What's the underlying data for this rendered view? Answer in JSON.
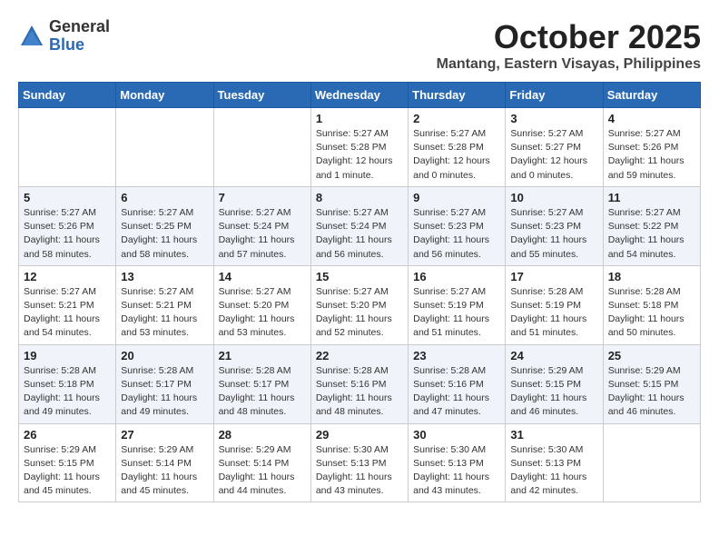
{
  "header": {
    "logo_general": "General",
    "logo_blue": "Blue",
    "month": "October 2025",
    "location": "Mantang, Eastern Visayas, Philippines"
  },
  "weekdays": [
    "Sunday",
    "Monday",
    "Tuesday",
    "Wednesday",
    "Thursday",
    "Friday",
    "Saturday"
  ],
  "weeks": [
    [
      {
        "day": "",
        "sunrise": "",
        "sunset": "",
        "daylight": ""
      },
      {
        "day": "",
        "sunrise": "",
        "sunset": "",
        "daylight": ""
      },
      {
        "day": "",
        "sunrise": "",
        "sunset": "",
        "daylight": ""
      },
      {
        "day": "1",
        "sunrise": "Sunrise: 5:27 AM",
        "sunset": "Sunset: 5:28 PM",
        "daylight": "Daylight: 12 hours and 1 minute."
      },
      {
        "day": "2",
        "sunrise": "Sunrise: 5:27 AM",
        "sunset": "Sunset: 5:28 PM",
        "daylight": "Daylight: 12 hours and 0 minutes."
      },
      {
        "day": "3",
        "sunrise": "Sunrise: 5:27 AM",
        "sunset": "Sunset: 5:27 PM",
        "daylight": "Daylight: 12 hours and 0 minutes."
      },
      {
        "day": "4",
        "sunrise": "Sunrise: 5:27 AM",
        "sunset": "Sunset: 5:26 PM",
        "daylight": "Daylight: 11 hours and 59 minutes."
      }
    ],
    [
      {
        "day": "5",
        "sunrise": "Sunrise: 5:27 AM",
        "sunset": "Sunset: 5:26 PM",
        "daylight": "Daylight: 11 hours and 58 minutes."
      },
      {
        "day": "6",
        "sunrise": "Sunrise: 5:27 AM",
        "sunset": "Sunset: 5:25 PM",
        "daylight": "Daylight: 11 hours and 58 minutes."
      },
      {
        "day": "7",
        "sunrise": "Sunrise: 5:27 AM",
        "sunset": "Sunset: 5:24 PM",
        "daylight": "Daylight: 11 hours and 57 minutes."
      },
      {
        "day": "8",
        "sunrise": "Sunrise: 5:27 AM",
        "sunset": "Sunset: 5:24 PM",
        "daylight": "Daylight: 11 hours and 56 minutes."
      },
      {
        "day": "9",
        "sunrise": "Sunrise: 5:27 AM",
        "sunset": "Sunset: 5:23 PM",
        "daylight": "Daylight: 11 hours and 56 minutes."
      },
      {
        "day": "10",
        "sunrise": "Sunrise: 5:27 AM",
        "sunset": "Sunset: 5:23 PM",
        "daylight": "Daylight: 11 hours and 55 minutes."
      },
      {
        "day": "11",
        "sunrise": "Sunrise: 5:27 AM",
        "sunset": "Sunset: 5:22 PM",
        "daylight": "Daylight: 11 hours and 54 minutes."
      }
    ],
    [
      {
        "day": "12",
        "sunrise": "Sunrise: 5:27 AM",
        "sunset": "Sunset: 5:21 PM",
        "daylight": "Daylight: 11 hours and 54 minutes."
      },
      {
        "day": "13",
        "sunrise": "Sunrise: 5:27 AM",
        "sunset": "Sunset: 5:21 PM",
        "daylight": "Daylight: 11 hours and 53 minutes."
      },
      {
        "day": "14",
        "sunrise": "Sunrise: 5:27 AM",
        "sunset": "Sunset: 5:20 PM",
        "daylight": "Daylight: 11 hours and 53 minutes."
      },
      {
        "day": "15",
        "sunrise": "Sunrise: 5:27 AM",
        "sunset": "Sunset: 5:20 PM",
        "daylight": "Daylight: 11 hours and 52 minutes."
      },
      {
        "day": "16",
        "sunrise": "Sunrise: 5:27 AM",
        "sunset": "Sunset: 5:19 PM",
        "daylight": "Daylight: 11 hours and 51 minutes."
      },
      {
        "day": "17",
        "sunrise": "Sunrise: 5:28 AM",
        "sunset": "Sunset: 5:19 PM",
        "daylight": "Daylight: 11 hours and 51 minutes."
      },
      {
        "day": "18",
        "sunrise": "Sunrise: 5:28 AM",
        "sunset": "Sunset: 5:18 PM",
        "daylight": "Daylight: 11 hours and 50 minutes."
      }
    ],
    [
      {
        "day": "19",
        "sunrise": "Sunrise: 5:28 AM",
        "sunset": "Sunset: 5:18 PM",
        "daylight": "Daylight: 11 hours and 49 minutes."
      },
      {
        "day": "20",
        "sunrise": "Sunrise: 5:28 AM",
        "sunset": "Sunset: 5:17 PM",
        "daylight": "Daylight: 11 hours and 49 minutes."
      },
      {
        "day": "21",
        "sunrise": "Sunrise: 5:28 AM",
        "sunset": "Sunset: 5:17 PM",
        "daylight": "Daylight: 11 hours and 48 minutes."
      },
      {
        "day": "22",
        "sunrise": "Sunrise: 5:28 AM",
        "sunset": "Sunset: 5:16 PM",
        "daylight": "Daylight: 11 hours and 48 minutes."
      },
      {
        "day": "23",
        "sunrise": "Sunrise: 5:28 AM",
        "sunset": "Sunset: 5:16 PM",
        "daylight": "Daylight: 11 hours and 47 minutes."
      },
      {
        "day": "24",
        "sunrise": "Sunrise: 5:29 AM",
        "sunset": "Sunset: 5:15 PM",
        "daylight": "Daylight: 11 hours and 46 minutes."
      },
      {
        "day": "25",
        "sunrise": "Sunrise: 5:29 AM",
        "sunset": "Sunset: 5:15 PM",
        "daylight": "Daylight: 11 hours and 46 minutes."
      }
    ],
    [
      {
        "day": "26",
        "sunrise": "Sunrise: 5:29 AM",
        "sunset": "Sunset: 5:15 PM",
        "daylight": "Daylight: 11 hours and 45 minutes."
      },
      {
        "day": "27",
        "sunrise": "Sunrise: 5:29 AM",
        "sunset": "Sunset: 5:14 PM",
        "daylight": "Daylight: 11 hours and 45 minutes."
      },
      {
        "day": "28",
        "sunrise": "Sunrise: 5:29 AM",
        "sunset": "Sunset: 5:14 PM",
        "daylight": "Daylight: 11 hours and 44 minutes."
      },
      {
        "day": "29",
        "sunrise": "Sunrise: 5:30 AM",
        "sunset": "Sunset: 5:13 PM",
        "daylight": "Daylight: 11 hours and 43 minutes."
      },
      {
        "day": "30",
        "sunrise": "Sunrise: 5:30 AM",
        "sunset": "Sunset: 5:13 PM",
        "daylight": "Daylight: 11 hours and 43 minutes."
      },
      {
        "day": "31",
        "sunrise": "Sunrise: 5:30 AM",
        "sunset": "Sunset: 5:13 PM",
        "daylight": "Daylight: 11 hours and 42 minutes."
      },
      {
        "day": "",
        "sunrise": "",
        "sunset": "",
        "daylight": ""
      }
    ]
  ]
}
